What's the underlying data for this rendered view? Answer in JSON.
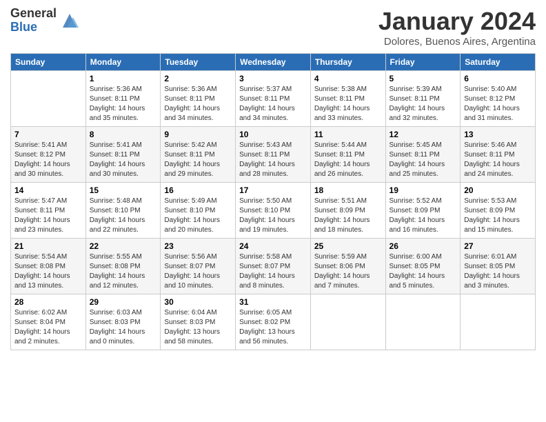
{
  "logo": {
    "general": "General",
    "blue": "Blue"
  },
  "header": {
    "month": "January 2024",
    "location": "Dolores, Buenos Aires, Argentina"
  },
  "days_of_week": [
    "Sunday",
    "Monday",
    "Tuesday",
    "Wednesday",
    "Thursday",
    "Friday",
    "Saturday"
  ],
  "weeks": [
    [
      {
        "day": "",
        "info": ""
      },
      {
        "day": "1",
        "info": "Sunrise: 5:36 AM\nSunset: 8:11 PM\nDaylight: 14 hours\nand 35 minutes."
      },
      {
        "day": "2",
        "info": "Sunrise: 5:36 AM\nSunset: 8:11 PM\nDaylight: 14 hours\nand 34 minutes."
      },
      {
        "day": "3",
        "info": "Sunrise: 5:37 AM\nSunset: 8:11 PM\nDaylight: 14 hours\nand 34 minutes."
      },
      {
        "day": "4",
        "info": "Sunrise: 5:38 AM\nSunset: 8:11 PM\nDaylight: 14 hours\nand 33 minutes."
      },
      {
        "day": "5",
        "info": "Sunrise: 5:39 AM\nSunset: 8:11 PM\nDaylight: 14 hours\nand 32 minutes."
      },
      {
        "day": "6",
        "info": "Sunrise: 5:40 AM\nSunset: 8:12 PM\nDaylight: 14 hours\nand 31 minutes."
      }
    ],
    [
      {
        "day": "7",
        "info": "Sunrise: 5:41 AM\nSunset: 8:12 PM\nDaylight: 14 hours\nand 30 minutes."
      },
      {
        "day": "8",
        "info": "Sunrise: 5:41 AM\nSunset: 8:11 PM\nDaylight: 14 hours\nand 30 minutes."
      },
      {
        "day": "9",
        "info": "Sunrise: 5:42 AM\nSunset: 8:11 PM\nDaylight: 14 hours\nand 29 minutes."
      },
      {
        "day": "10",
        "info": "Sunrise: 5:43 AM\nSunset: 8:11 PM\nDaylight: 14 hours\nand 28 minutes."
      },
      {
        "day": "11",
        "info": "Sunrise: 5:44 AM\nSunset: 8:11 PM\nDaylight: 14 hours\nand 26 minutes."
      },
      {
        "day": "12",
        "info": "Sunrise: 5:45 AM\nSunset: 8:11 PM\nDaylight: 14 hours\nand 25 minutes."
      },
      {
        "day": "13",
        "info": "Sunrise: 5:46 AM\nSunset: 8:11 PM\nDaylight: 14 hours\nand 24 minutes."
      }
    ],
    [
      {
        "day": "14",
        "info": "Sunrise: 5:47 AM\nSunset: 8:11 PM\nDaylight: 14 hours\nand 23 minutes."
      },
      {
        "day": "15",
        "info": "Sunrise: 5:48 AM\nSunset: 8:10 PM\nDaylight: 14 hours\nand 22 minutes."
      },
      {
        "day": "16",
        "info": "Sunrise: 5:49 AM\nSunset: 8:10 PM\nDaylight: 14 hours\nand 20 minutes."
      },
      {
        "day": "17",
        "info": "Sunrise: 5:50 AM\nSunset: 8:10 PM\nDaylight: 14 hours\nand 19 minutes."
      },
      {
        "day": "18",
        "info": "Sunrise: 5:51 AM\nSunset: 8:09 PM\nDaylight: 14 hours\nand 18 minutes."
      },
      {
        "day": "19",
        "info": "Sunrise: 5:52 AM\nSunset: 8:09 PM\nDaylight: 14 hours\nand 16 minutes."
      },
      {
        "day": "20",
        "info": "Sunrise: 5:53 AM\nSunset: 8:09 PM\nDaylight: 14 hours\nand 15 minutes."
      }
    ],
    [
      {
        "day": "21",
        "info": "Sunrise: 5:54 AM\nSunset: 8:08 PM\nDaylight: 14 hours\nand 13 minutes."
      },
      {
        "day": "22",
        "info": "Sunrise: 5:55 AM\nSunset: 8:08 PM\nDaylight: 14 hours\nand 12 minutes."
      },
      {
        "day": "23",
        "info": "Sunrise: 5:56 AM\nSunset: 8:07 PM\nDaylight: 14 hours\nand 10 minutes."
      },
      {
        "day": "24",
        "info": "Sunrise: 5:58 AM\nSunset: 8:07 PM\nDaylight: 14 hours\nand 8 minutes."
      },
      {
        "day": "25",
        "info": "Sunrise: 5:59 AM\nSunset: 8:06 PM\nDaylight: 14 hours\nand 7 minutes."
      },
      {
        "day": "26",
        "info": "Sunrise: 6:00 AM\nSunset: 8:05 PM\nDaylight: 14 hours\nand 5 minutes."
      },
      {
        "day": "27",
        "info": "Sunrise: 6:01 AM\nSunset: 8:05 PM\nDaylight: 14 hours\nand 3 minutes."
      }
    ],
    [
      {
        "day": "28",
        "info": "Sunrise: 6:02 AM\nSunset: 8:04 PM\nDaylight: 14 hours\nand 2 minutes."
      },
      {
        "day": "29",
        "info": "Sunrise: 6:03 AM\nSunset: 8:03 PM\nDaylight: 14 hours\nand 0 minutes."
      },
      {
        "day": "30",
        "info": "Sunrise: 6:04 AM\nSunset: 8:03 PM\nDaylight: 13 hours\nand 58 minutes."
      },
      {
        "day": "31",
        "info": "Sunrise: 6:05 AM\nSunset: 8:02 PM\nDaylight: 13 hours\nand 56 minutes."
      },
      {
        "day": "",
        "info": ""
      },
      {
        "day": "",
        "info": ""
      },
      {
        "day": "",
        "info": ""
      }
    ]
  ]
}
